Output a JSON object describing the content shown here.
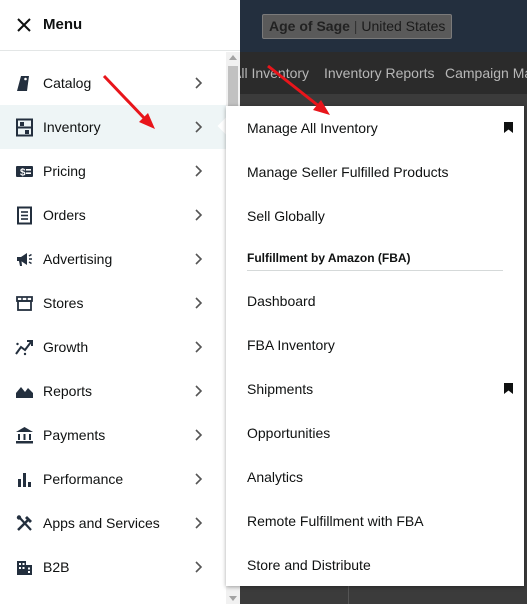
{
  "background": {
    "store_name": "Age of Sage",
    "store_sep": "|",
    "store_region": "United States",
    "nav_items": [
      "All Inventory",
      "Inventory Reports",
      "Campaign Ma"
    ]
  },
  "menu": {
    "title": "Menu",
    "items": [
      {
        "label": "Catalog",
        "icon": "catalog-tag-icon"
      },
      {
        "label": "Inventory",
        "icon": "inventory-shelves-icon",
        "active": true
      },
      {
        "label": "Pricing",
        "icon": "pricing-dollar-icon"
      },
      {
        "label": "Orders",
        "icon": "orders-clipboard-icon"
      },
      {
        "label": "Advertising",
        "icon": "megaphone-icon"
      },
      {
        "label": "Stores",
        "icon": "storefront-icon"
      },
      {
        "label": "Growth",
        "icon": "growth-chart-icon"
      },
      {
        "label": "Reports",
        "icon": "reports-area-chart-icon"
      },
      {
        "label": "Payments",
        "icon": "bank-icon"
      },
      {
        "label": "Performance",
        "icon": "bar-chart-icon"
      },
      {
        "label": "Apps and Services",
        "icon": "tools-icon"
      },
      {
        "label": "B2B",
        "icon": "building-icon"
      }
    ]
  },
  "submenu": {
    "items_top": [
      {
        "label": "Manage All Inventory",
        "bookmarked": true
      },
      {
        "label": "Manage Seller Fulfilled Products",
        "bookmarked": false
      },
      {
        "label": "Sell Globally",
        "bookmarked": false
      }
    ],
    "section_heading": "Fulfillment by Amazon (FBA)",
    "items_fba": [
      {
        "label": "Dashboard",
        "bookmarked": false
      },
      {
        "label": "FBA Inventory",
        "bookmarked": false
      },
      {
        "label": "Shipments",
        "bookmarked": true
      },
      {
        "label": "Opportunities",
        "bookmarked": false
      },
      {
        "label": "Analytics",
        "bookmarked": false
      },
      {
        "label": "Remote Fulfillment with FBA",
        "bookmarked": false
      },
      {
        "label": "Store and Distribute",
        "bookmarked": false
      }
    ]
  },
  "colors": {
    "annotation_arrow": "#e8151b",
    "active_row": "#eef5f6",
    "text": "#0f1111",
    "topbar": "#232f3e"
  }
}
